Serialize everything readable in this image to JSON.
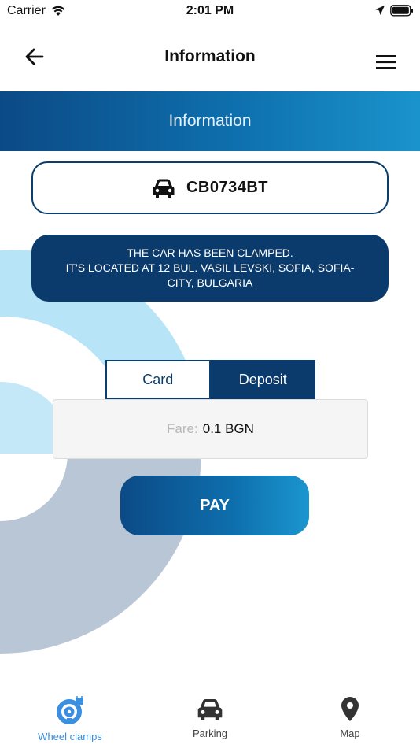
{
  "status_bar": {
    "carrier": "Carrier",
    "time": "2:01 PM"
  },
  "header": {
    "title": "Information"
  },
  "banner": {
    "title": "Information"
  },
  "vehicle": {
    "plate": "CB0734BT"
  },
  "alert": {
    "line1": "THE CAR HAS BEEN CLAMPED.",
    "line2": "IT'S LOCATED AT  12 BUL. VASIL LEVSKI, SOFIA, SOFIA-",
    "line3": "CITY, BULGARIA"
  },
  "payment_tabs": {
    "card": "Card",
    "deposit": "Deposit",
    "selected": "Deposit"
  },
  "fare": {
    "label": "Fare:",
    "value": "0.1 BGN"
  },
  "pay_button": {
    "label": "PAY"
  },
  "tab_bar": {
    "items": [
      {
        "label": "Wheel clamps",
        "icon": "wheel-clamp-icon",
        "active": true
      },
      {
        "label": "Parking",
        "icon": "car-icon",
        "active": false
      },
      {
        "label": "Map",
        "icon": "map-pin-icon",
        "active": false
      }
    ]
  },
  "colors": {
    "primary_dark": "#0b3b6c",
    "accent": "#1a93cc",
    "active_tab": "#3a8fe0"
  }
}
